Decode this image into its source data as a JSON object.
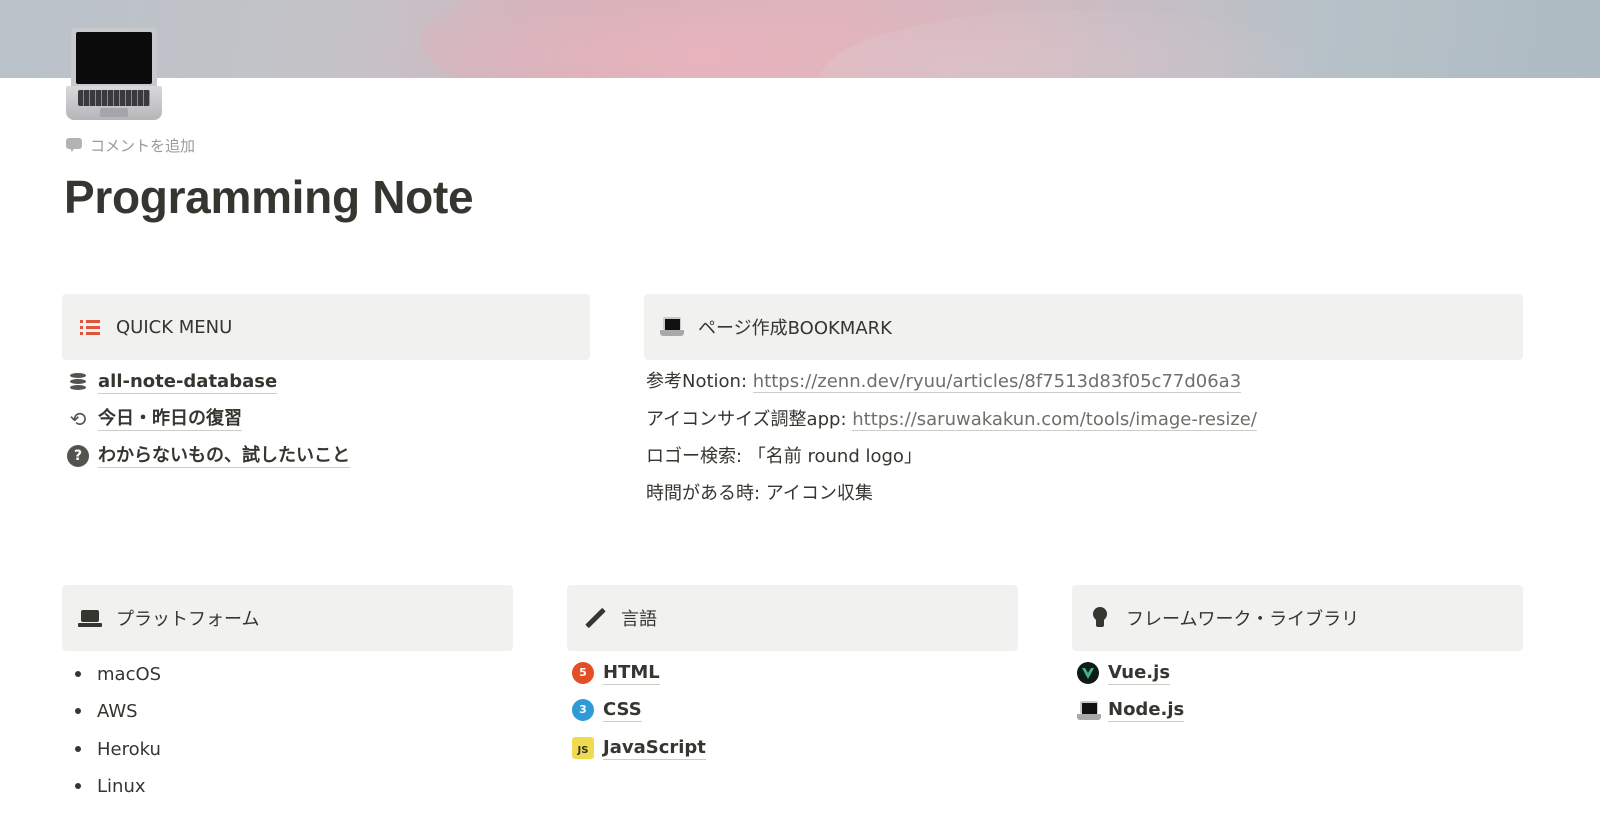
{
  "page": {
    "title": "Programming Note",
    "add_comment": "コメントを追加",
    "icon": "laptop-icon"
  },
  "quick_menu": {
    "header": "QUICK MENU",
    "icon": "list-icon",
    "items": [
      {
        "label": "all-note-database",
        "icon": "database-icon"
      },
      {
        "label": "今日・昨日の復習",
        "icon": "refresh-icon"
      },
      {
        "label": "わからないもの、試したいこと",
        "icon": "question-icon"
      }
    ]
  },
  "bookmark": {
    "header": "ページ作成BOOKMARK",
    "icon": "laptop-icon",
    "rows": [
      {
        "label": "参考Notion: ",
        "link": "https://zenn.dev/ryuu/articles/8f7513d83f05c77d06a3"
      },
      {
        "label": "アイコンサイズ調整app: ",
        "link": "https://saruwakakun.com/tools/image-resize/"
      },
      {
        "label": "ロゴー検索: 「名前 round logo」",
        "link": null
      },
      {
        "label": "時間がある時: アイコン収集",
        "link": null
      }
    ]
  },
  "platform": {
    "header": "プラットフォーム",
    "icon": "laptop-icon",
    "items": [
      "macOS",
      "AWS",
      "Heroku",
      "Linux"
    ]
  },
  "language": {
    "header": "言語",
    "icon": "pencil-icon",
    "items": [
      {
        "label": "HTML",
        "icon": "html5-icon",
        "badge": "5"
      },
      {
        "label": "CSS",
        "icon": "css3-icon",
        "badge": "3"
      },
      {
        "label": "JavaScript",
        "icon": "js-icon",
        "badge": "JS"
      }
    ]
  },
  "framework": {
    "header": "フレームワーク・ライブラリ",
    "icon": "lightbulb-icon",
    "items": [
      {
        "label": "Vue.js",
        "icon": "vue-icon"
      },
      {
        "label": "Node.js",
        "icon": "laptop-icon"
      }
    ]
  },
  "colors": {
    "callout_bg": "#f1f1ef",
    "text": "#37352f",
    "muted": "#9b9a97",
    "link": "#6f6e69",
    "list_icon": "#e0533d"
  }
}
